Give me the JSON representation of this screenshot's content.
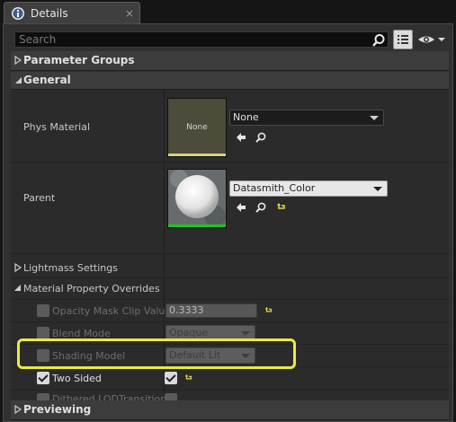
{
  "tab": {
    "title": "Details",
    "close": "×",
    "icon": "info-icon"
  },
  "search": {
    "placeholder": "Search",
    "icon": "search-icon"
  },
  "toolbar": {
    "view_options_icon": "list-view-icon",
    "visibility_icon": "eye-icon"
  },
  "categories": {
    "parameter_groups": "Parameter Groups",
    "general": "General",
    "previewing": "Previewing"
  },
  "general": {
    "phys_material": {
      "label": "Phys Material",
      "thumbnail_text": "None",
      "value": "None"
    },
    "parent": {
      "label": "Parent",
      "value": "Datasmith_Color"
    },
    "lightmass_settings": "Lightmass Settings",
    "material_property_overrides": "Material Property Overrides",
    "overrides": [
      {
        "label": "Opacity Mask Clip Value",
        "value": "0.3333"
      },
      {
        "label": "Blend Mode",
        "value": "Opaque"
      },
      {
        "label": "Shading Model",
        "value": "Default Lit"
      },
      {
        "label": "Two Sided",
        "checked": true
      },
      {
        "label": "Dithered LODTransition"
      }
    ]
  },
  "colors": {
    "highlight": "#eaea3c",
    "asset_bar_green": "#22c322",
    "panel_bg": "#303030"
  }
}
